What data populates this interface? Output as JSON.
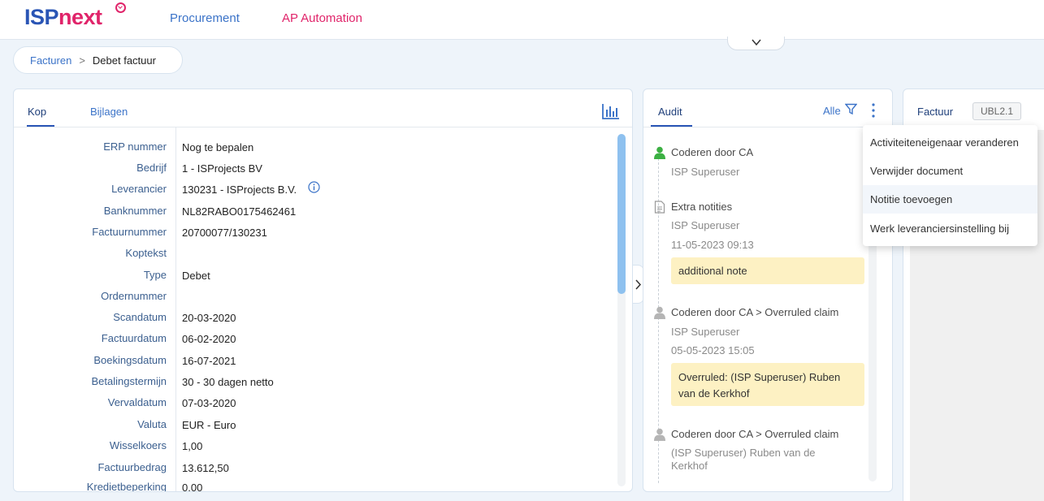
{
  "header": {
    "logo_isp": "ISP",
    "logo_next": "next",
    "nav": [
      "Procurement",
      "AP Automation"
    ]
  },
  "breadcrumb": {
    "parent": "Facturen",
    "separator": ">",
    "current": "Debet factuur"
  },
  "main": {
    "tabs": [
      "Kop",
      "Bijlagen"
    ],
    "active_tab": "Kop",
    "fields": [
      {
        "label": "ERP nummer",
        "value": "Nog te bepalen"
      },
      {
        "label": "Bedrijf",
        "value": "1 - ISProjects BV"
      },
      {
        "label": "Leverancier",
        "value": "130231 - ISProjects B.V."
      },
      {
        "label": "Banknummer",
        "value": "NL82RABO0175462461"
      },
      {
        "label": "Factuurnummer",
        "value": "20700077/130231"
      },
      {
        "label": "Koptekst",
        "value": ""
      },
      {
        "label": "Type",
        "value": "Debet"
      },
      {
        "label": "Ordernummer",
        "value": ""
      },
      {
        "label": "Scandatum",
        "value": "20-03-2020"
      },
      {
        "label": "Factuurdatum",
        "value": "06-02-2020"
      },
      {
        "label": "Boekingsdatum",
        "value": "16-07-2021"
      },
      {
        "label": "Betalingstermijn",
        "value": "30 - 30 dagen netto"
      },
      {
        "label": "Vervaldatum",
        "value": "07-03-2020"
      },
      {
        "label": "Valuta",
        "value": "EUR - Euro"
      },
      {
        "label": "Wisselkoers",
        "value": "1,00"
      },
      {
        "label": "Factuurbedrag",
        "value": "13.612,50"
      },
      {
        "label": "Kredietbeperking",
        "value": "0,00"
      }
    ]
  },
  "audit": {
    "tab": "Audit",
    "filter_label": "Alle",
    "items": [
      {
        "icon": "user-green-icon",
        "title": "Coderen door CA",
        "user": "ISP Superuser",
        "date": "",
        "note": ""
      },
      {
        "icon": "document-icon",
        "title": "Extra notities",
        "user": "ISP Superuser",
        "date": "11-05-2023 09:13",
        "note": "additional note"
      },
      {
        "icon": "user-grey-icon",
        "title": "Coderen door CA > Overruled claim",
        "user": "ISP Superuser",
        "date": "05-05-2023 15:05",
        "note": "Overruled: (ISP Superuser) Ruben van de Kerkhof"
      },
      {
        "icon": "user-grey-icon",
        "title": "Coderen door CA > Overruled claim",
        "user": "(ISP Superuser) Ruben van de Kerkhof",
        "date": "",
        "note": ""
      }
    ]
  },
  "factuur": {
    "tab": "Factuur",
    "badge": "UBL2.1"
  },
  "menu": {
    "items": [
      "Activiteiteneigenaar veranderen",
      "Verwijder document",
      "Notitie toevoegen",
      "Werk leveranciersinstelling bij"
    ],
    "hovered_index": 2
  }
}
